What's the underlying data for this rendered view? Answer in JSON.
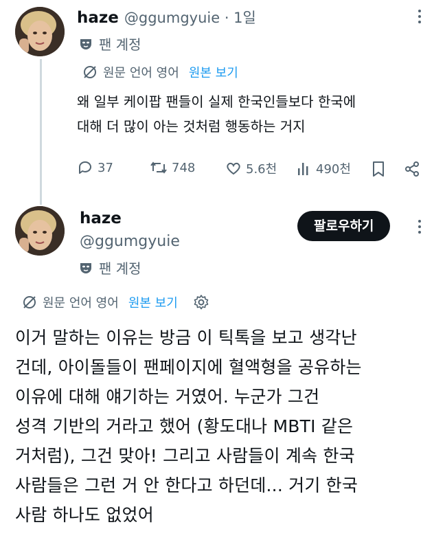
{
  "reply_tweet": {
    "display_name": "haze",
    "handle_time": "@ggumgyuie · 1일",
    "account_label": "팬 계정",
    "translate_label": "원문 언어 영어",
    "view_original": "원본 보기",
    "text": "왜 일부 케이팝 팬들이 실제 한국인들보다 한국에\n대해 더 많이 아는 것처럼 행동하는 거지",
    "stats": {
      "replies": "37",
      "reposts": "748",
      "likes": "5.6천",
      "views": "490천"
    }
  },
  "main_tweet": {
    "display_name": "haze",
    "handle": "@ggumgyuie",
    "account_label": "팬 계정",
    "follow_label": "팔로우하기",
    "translate_label": "원문 언어 영어",
    "view_original": "원본 보기",
    "text": "이거 말하는 이유는 방금 이 틱톡을 보고 생각난\n건데, 아이돌들이 팬페이지에 혈액형을 공유하는\n이유에 대해 얘기하는 거였어. 누군가 그건\n성격 기반의 거라고 했어 (황도대나 MBTI 같은\n거처럼), 그건 맞아! 그리고 사람들이 계속 한국\n사람들은 그런 거 안 한다고 하던데... 거기 한국\n사람 하나도 없었어"
  },
  "colors": {
    "text": "#0f1419",
    "secondary": "#536471",
    "link": "#1d9bf0",
    "follow_bg": "#0f1419"
  }
}
